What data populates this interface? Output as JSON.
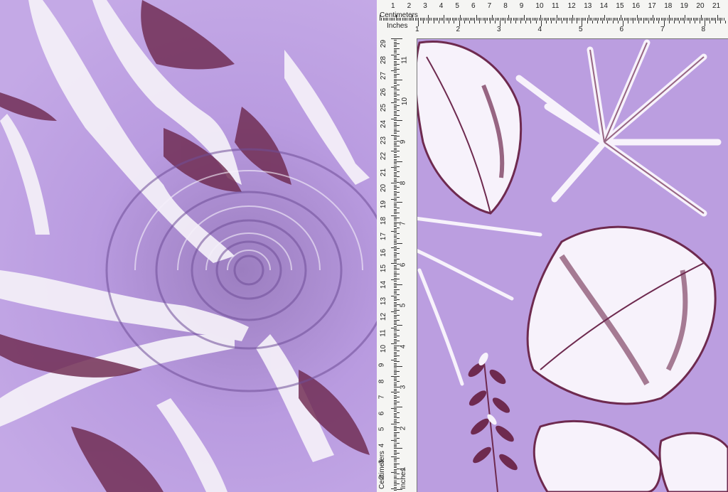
{
  "ruler": {
    "cm_label": "Centimeters",
    "in_label": "Inches",
    "cm_numbers": [
      "1",
      "2",
      "3",
      "4",
      "5",
      "6",
      "7",
      "8",
      "9",
      "10",
      "11",
      "12",
      "13",
      "14",
      "15",
      "16",
      "17",
      "18",
      "19",
      "20",
      "21"
    ],
    "in_numbers": [
      "1",
      "2",
      "3",
      "4",
      "5",
      "6",
      "7",
      "8"
    ],
    "vertical_cm_numbers": [
      "2",
      "3",
      "4",
      "5",
      "6",
      "7",
      "8",
      "9",
      "10",
      "11",
      "12",
      "13",
      "14",
      "15",
      "16",
      "17",
      "18",
      "19",
      "20",
      "21",
      "22",
      "23",
      "24",
      "25",
      "26",
      "27",
      "28",
      "29"
    ],
    "vertical_in_numbers": [
      "1",
      "2",
      "3",
      "4",
      "5",
      "6",
      "7",
      "8",
      "9",
      "10",
      "11"
    ],
    "vertical_cm_label": "Centimeters",
    "vertical_in_label": "Inches"
  },
  "colors": {
    "background": "#b89ad8",
    "leaf_white": "#f7f2fb",
    "leaf_plum": "#6e2a4f",
    "ruler": "#f5f5f3"
  }
}
